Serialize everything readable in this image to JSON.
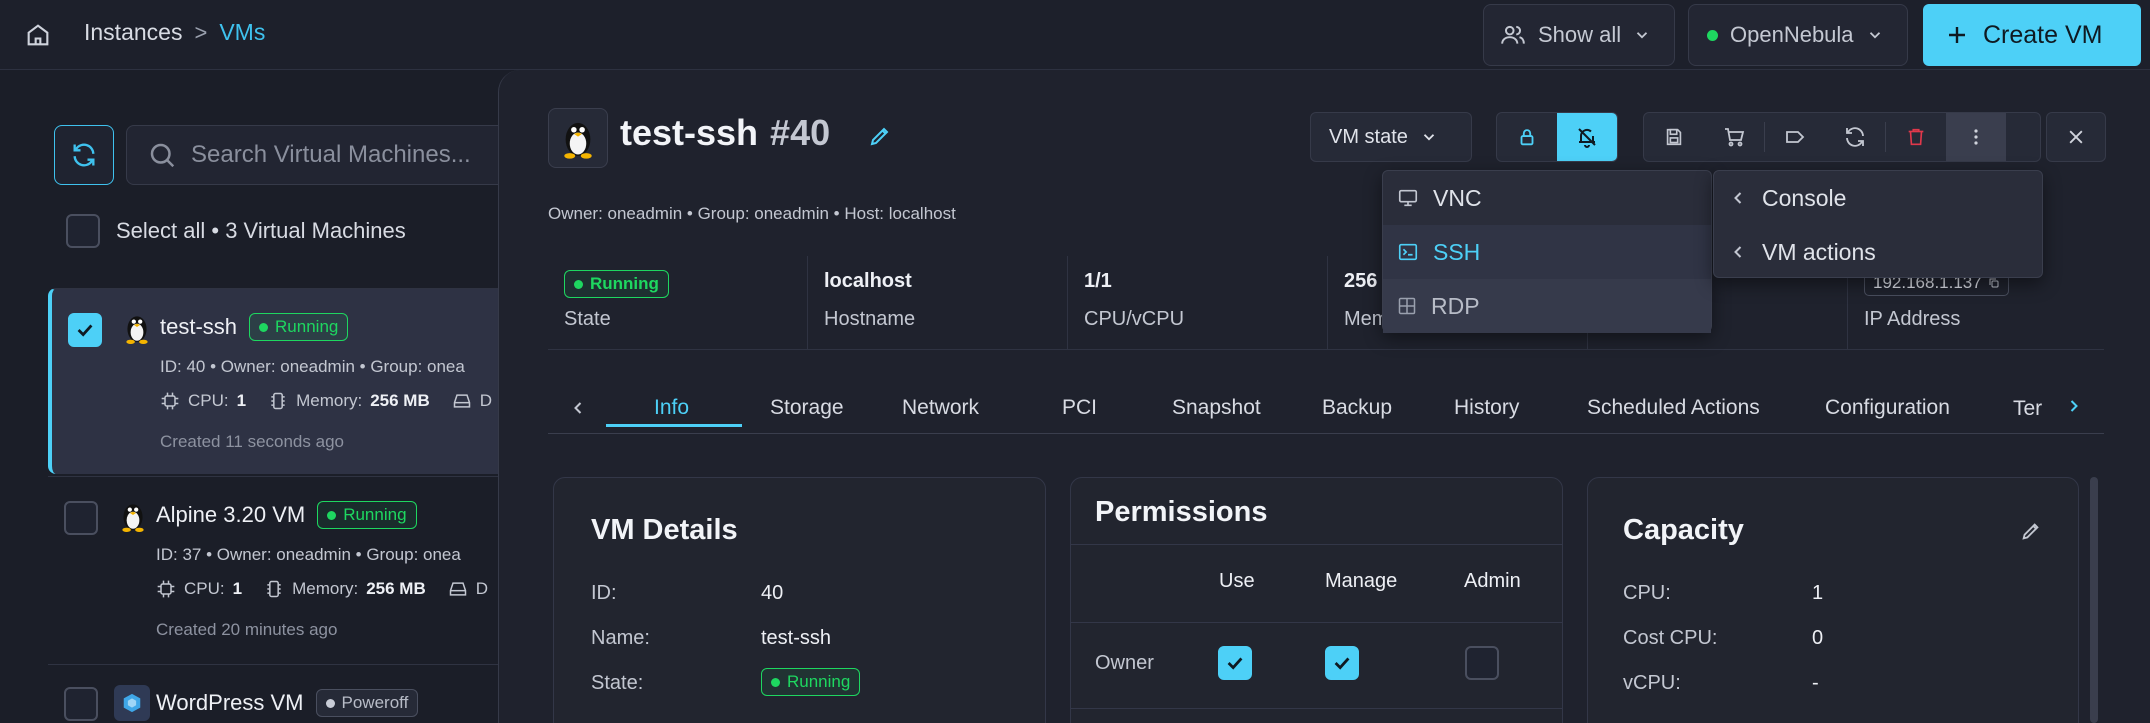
{
  "header": {
    "breadcrumb": [
      "Instances",
      "VMs"
    ],
    "show_all_label": "Show all",
    "zone_label": "OpenNebula",
    "create_label": "Create VM"
  },
  "list": {
    "search_placeholder": "Search Virtual Machines...",
    "select_all_label": "Select all • 3 Virtual Machines",
    "vms": [
      {
        "name": "test-ssh",
        "status": "Running",
        "meta": "ID: 40 • Owner: oneadmin • Group: onea",
        "cpu_label": "CPU:",
        "cpu": "1",
        "mem_label": "Memory:",
        "mem": "256 MB",
        "disk_label": "D",
        "created": "Created 11 seconds ago",
        "selected": true
      },
      {
        "name": "Alpine 3.20 VM",
        "status": "Running",
        "meta": "ID: 37 • Owner: oneadmin • Group: onea",
        "cpu_label": "CPU:",
        "cpu": "1",
        "mem_label": "Memory:",
        "mem": "256 MB",
        "disk_label": "D",
        "created": "Created 20 minutes ago",
        "selected": false
      },
      {
        "name": "WordPress VM",
        "status": "Poweroff",
        "selected": false
      }
    ]
  },
  "detail": {
    "name": "test-ssh",
    "id_label": "#40",
    "owner_line": "Owner: oneadmin • Group: oneadmin • Host: localhost",
    "vm_state_label": "VM state",
    "info": {
      "state_badge": "Running",
      "state_label": "State",
      "hostname": "localhost",
      "hostname_label": "Hostname",
      "cpu": "1/1",
      "cpu_label": "CPU/vCPU",
      "mem": "256",
      "mem_label": "Mem",
      "ip": "192.168.1.137",
      "ip_label": "IP Address"
    },
    "tabs": [
      "Info",
      "Storage",
      "Network",
      "PCI",
      "Snapshot",
      "Backup",
      "History",
      "Scheduled Actions",
      "Configuration",
      "Ter"
    ],
    "active_tab": "Info",
    "vm_details": {
      "title": "VM Details",
      "rows": [
        {
          "key": "ID:",
          "value": "40"
        },
        {
          "key": "Name:",
          "value": "test-ssh"
        },
        {
          "key": "State:",
          "value": "Running"
        }
      ]
    },
    "permissions": {
      "title": "Permissions",
      "columns": [
        "Use",
        "Manage",
        "Admin"
      ],
      "rows": [
        {
          "label": "Owner"
        }
      ]
    },
    "capacity": {
      "title": "Capacity",
      "rows": [
        {
          "key": "CPU:",
          "value": "1"
        },
        {
          "key": "Cost CPU:",
          "value": "0"
        },
        {
          "key": "vCPU:",
          "value": "-"
        }
      ]
    }
  },
  "menus": {
    "remote": [
      "VNC",
      "SSH",
      "RDP"
    ],
    "more": [
      "Console",
      "VM actions"
    ]
  },
  "colors": {
    "accent": "#4dd0f7",
    "running": "#1ed760",
    "danger": "#e0384b"
  }
}
